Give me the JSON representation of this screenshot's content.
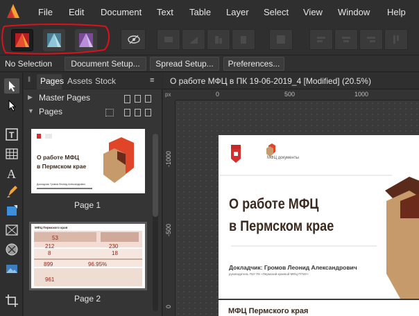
{
  "menu": [
    "File",
    "Edit",
    "Document",
    "Text",
    "Table",
    "Layer",
    "Select",
    "View",
    "Window",
    "Help"
  ],
  "personas": [
    "designer-persona-icon",
    "photo-persona-icon",
    "publisher-persona-icon"
  ],
  "context": {
    "selection": "No Selection",
    "buttons": [
      "Document Setup...",
      "Spread Setup...",
      "Preferences..."
    ]
  },
  "panel": {
    "tabs": [
      "Pages",
      "Assets",
      "Stock"
    ],
    "master_pages": "Master Pages",
    "pages": "Pages",
    "page_labels": [
      "Page 1",
      "Page 2"
    ],
    "thumb1": {
      "title_line1": "О работе МФЦ",
      "title_line2": "в Пермском крае",
      "footer": "Докладчик: Громов Леонид Александрович"
    },
    "thumb2": {
      "header": "МФЦ Пермского края",
      "numbers": [
        "53",
        "212",
        "8",
        "899",
        "96.95%",
        "961",
        "230",
        "18"
      ]
    }
  },
  "document": {
    "tab_title": "О работе МФЦ в ПК 19-06-2019_4 [Modified] (20.5%)",
    "ruler_unit": "px",
    "ruler_top": [
      "0",
      "500",
      "1000"
    ],
    "ruler_left": [
      "-1000",
      "-500",
      "0"
    ],
    "slide_title_line1": "О работе МФЦ",
    "slide_title_line2": "в Пермском крае",
    "reporter": "Докладчик: Громов Леонид Александрович",
    "reporter_sub": "руководитель ГБУ ПК «Пермский краевой МФЦ ПГМУ»",
    "page2_title": "МФЦ Пермского края",
    "mfc_logo_text": "МФЦ документы"
  },
  "colors": {
    "accent_red": "#e0452a",
    "logo_brown": "#c79a6c",
    "title_brown": "#3b2a1f",
    "annotation_red": "#e0101a"
  }
}
